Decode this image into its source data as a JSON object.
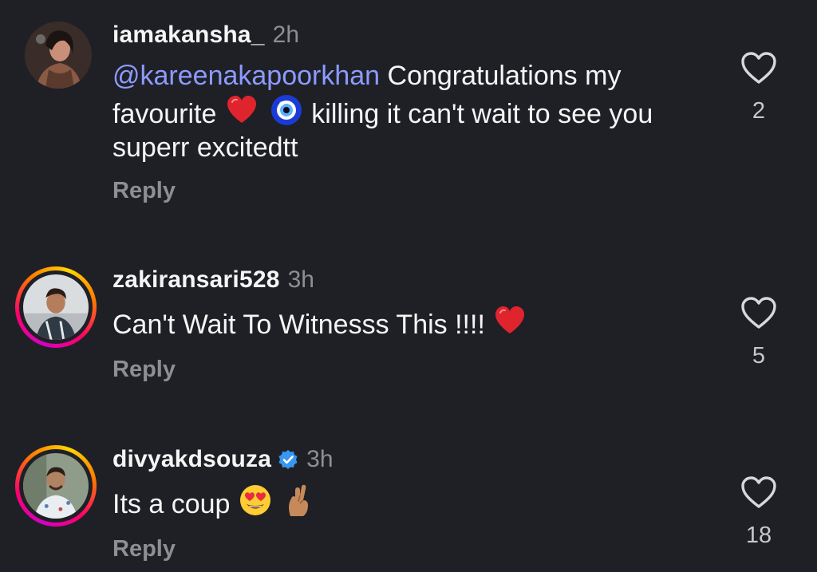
{
  "comments": [
    {
      "username": "iamakansha_",
      "time": "2h",
      "mention": "@kareenakapoorkhan",
      "text_part1": " Congratulations my favourite ",
      "text_part2": " killing it can't wait to see you superr excitedtt",
      "emojis": [
        "red-heart",
        "nazar-amulet"
      ],
      "reply_label": "Reply",
      "like_count": "2",
      "has_story_ring": false,
      "verified": false
    },
    {
      "username": "zakiransari528",
      "time": "3h",
      "text_part1": "Can't Wait To Witnesss This !!!! ",
      "emojis": [
        "red-heart"
      ],
      "reply_label": "Reply",
      "like_count": "5",
      "has_story_ring": true,
      "verified": false
    },
    {
      "username": "divyakdsouza",
      "time": "3h",
      "text_part1": "Its a coup ",
      "emojis": [
        "heart-eyes-face",
        "crossed-fingers"
      ],
      "reply_label": "Reply",
      "like_count": "18",
      "has_story_ring": true,
      "verified": true
    }
  ],
  "colors": {
    "background": "#1f2026",
    "mention": "#8c9bff",
    "muted": "#8e8e93",
    "verified_badge": "#3897f0"
  }
}
